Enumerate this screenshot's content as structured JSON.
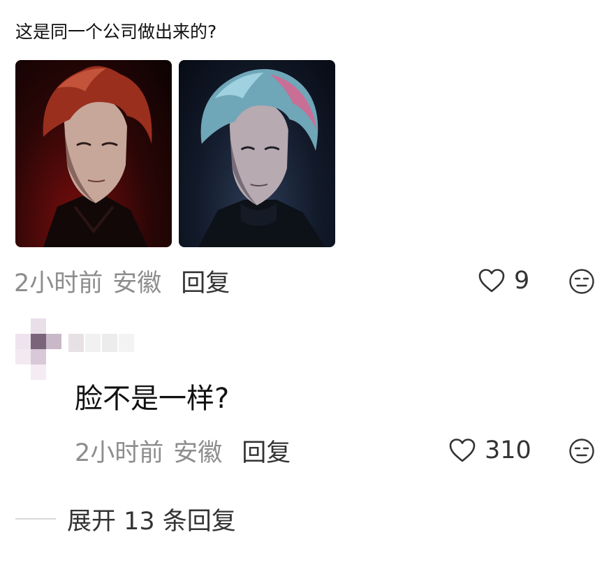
{
  "comment": {
    "text": "这是同一个公司做出来的?",
    "images": [
      {
        "description": "red-haired male character portrait"
      },
      {
        "description": "blue-haired male character portrait"
      }
    ],
    "time": "2小时前",
    "location": "安徽",
    "reply_label": "回复",
    "like_count": "9"
  },
  "reply": {
    "text": "脸不是一样?",
    "time": "2小时前",
    "location": "安徽",
    "reply_label": "回复",
    "like_count": "310"
  },
  "expand": {
    "label": "展开 13 条回复"
  },
  "icons": {
    "like": "heart-outline-icon",
    "emoji": "neutral-face-icon"
  },
  "colors": {
    "meta_gray": "#8d8d8d",
    "primary_text": "#111111",
    "action_text": "#333333"
  }
}
